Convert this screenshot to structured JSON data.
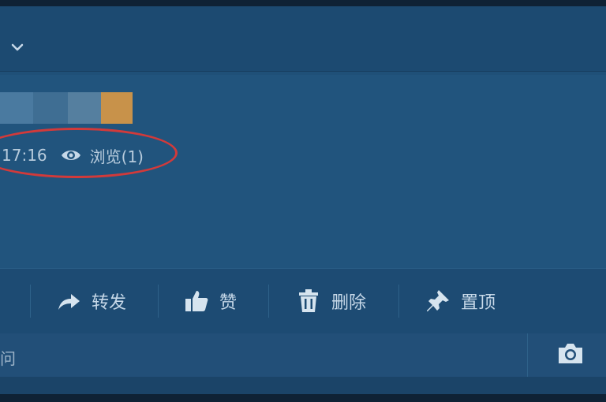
{
  "post": {
    "time": "17:16",
    "views": "浏览(1)"
  },
  "actions": {
    "forward": "转发",
    "like": "赞",
    "delete": "删除",
    "pin": "置顶"
  },
  "comment": {
    "placeholder_fragment": "问"
  },
  "icons": {
    "header": "chevron-down-icon",
    "views": "eye-icon",
    "forward": "share-arrow-icon",
    "like": "thumbs-up-icon",
    "delete": "trash-icon",
    "pin": "pin-icon",
    "camera": "camera-icon"
  },
  "colors": {
    "background": "#1f5078",
    "highlight_circle": "#d23a3a",
    "text": "#c6d8e8"
  }
}
